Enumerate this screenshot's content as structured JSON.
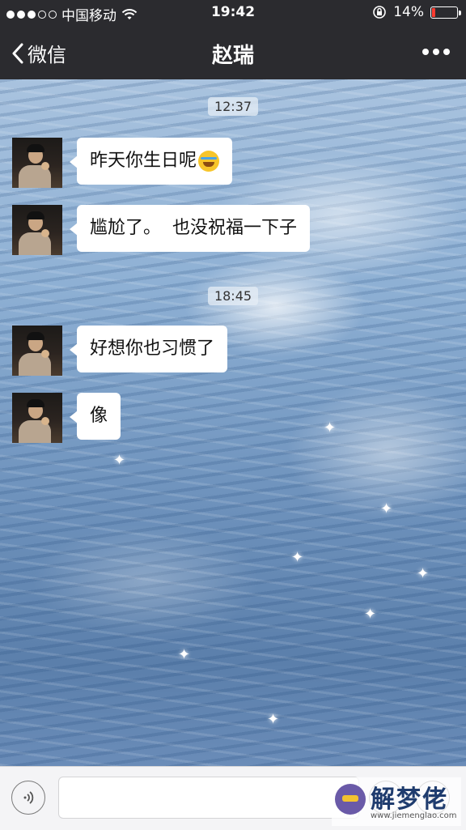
{
  "status_bar": {
    "carrier": "中国移动",
    "time": "19:42",
    "battery_percent": "14%",
    "battery_level": 0.14,
    "signal_dots_filled": 3,
    "signal_dots_total": 5,
    "icons": [
      "wifi-icon",
      "rotation-lock-icon",
      "battery-icon"
    ]
  },
  "nav": {
    "back_label": "微信",
    "title": "赵瑞",
    "more_icon": "more-dots-icon"
  },
  "messages": [
    {
      "type": "time",
      "text": "12:37"
    },
    {
      "type": "incoming",
      "text": "昨天你生日呢",
      "emoji": "crying-laughing-emoji"
    },
    {
      "type": "incoming",
      "text": "尴尬了。  也没祝福一下子"
    },
    {
      "type": "time",
      "text": "18:45"
    },
    {
      "type": "incoming",
      "text": "好想你也习惯了"
    },
    {
      "type": "incoming",
      "text": "像"
    }
  ],
  "input_bar": {
    "voice_icon": "voice-icon",
    "text_value": "",
    "plus_icon": "plus-icon"
  },
  "watermark": {
    "title": "解梦佬",
    "url": "www.jiemenglao.com"
  },
  "colors": {
    "bar_bg": "#2b2b2f",
    "bubble_bg": "#ffffff",
    "battery_low": "#ff3b30"
  }
}
